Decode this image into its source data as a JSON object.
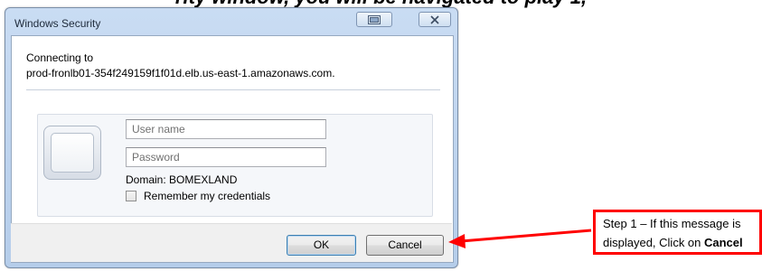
{
  "caption": {
    "text": "rity window, you will be navigated to play 1,"
  },
  "window": {
    "title": "Windows Security",
    "connecting_label": "Connecting to",
    "host": "prod-fronlb01-354f249159f1f01d.elb.us-east-1.amazonaws.com.",
    "username_placeholder": "User name",
    "password_placeholder": "Password",
    "domain_text": "Domain: BOMEXLAND",
    "remember_label": "Remember my credentials",
    "ok_label": "OK",
    "cancel_label": "Cancel"
  },
  "callout": {
    "line1": "Step 1 – If this message is",
    "line2_prefix": "displayed, Click on ",
    "line2_emphasis": "Cancel",
    "border_color": "#ff0000"
  },
  "icons": {
    "restore": "restore-icon",
    "close": "close-icon",
    "avatar": "user-avatar-icon",
    "arrow": "red-arrow-icon"
  }
}
